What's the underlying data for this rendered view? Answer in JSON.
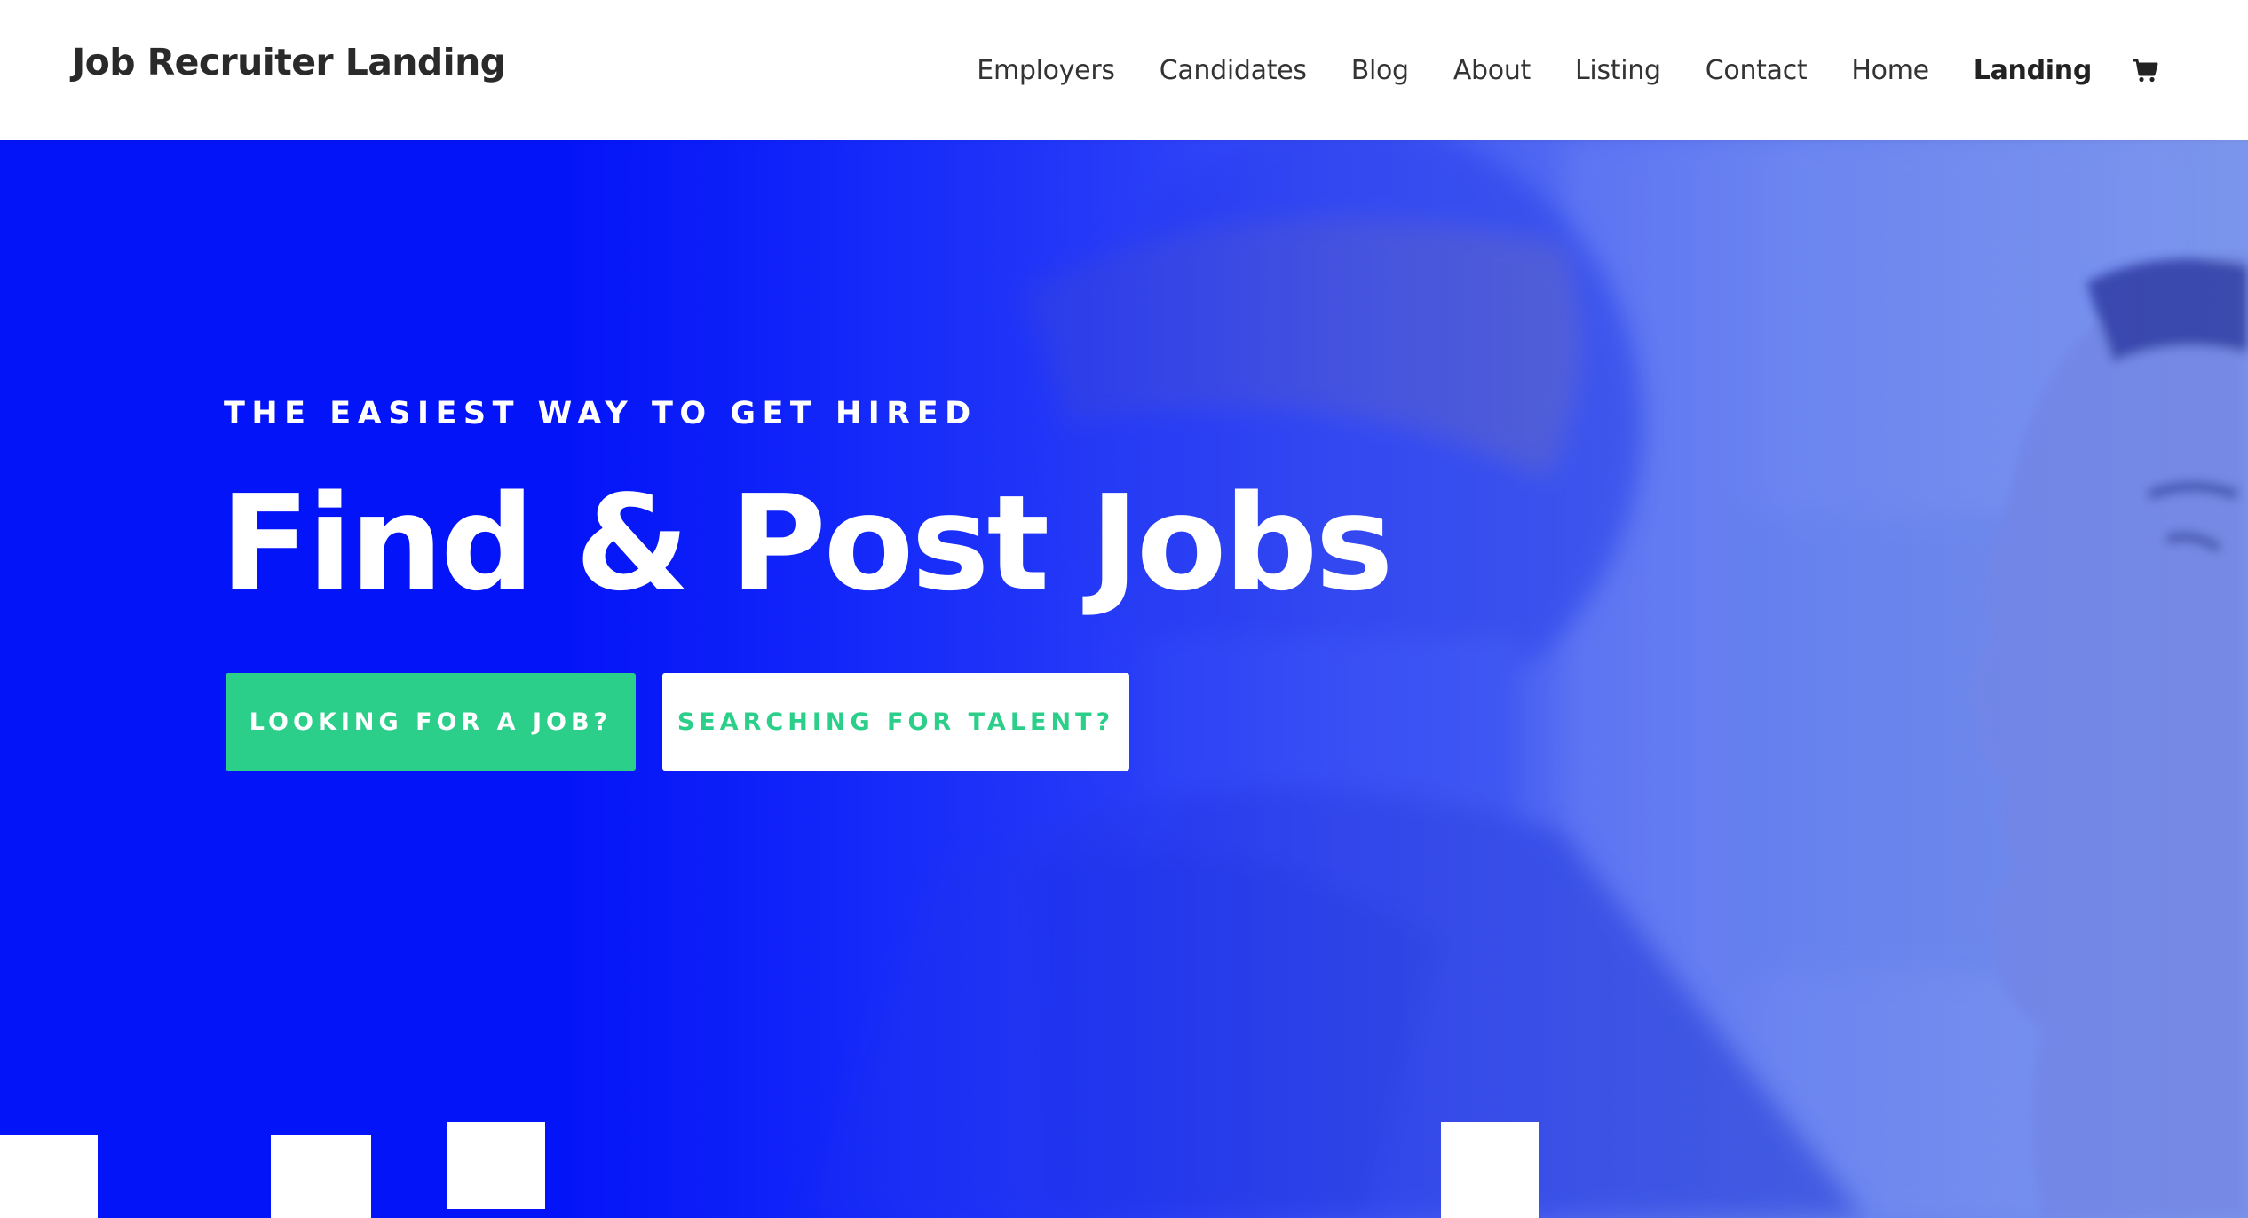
{
  "header": {
    "logo": "Job Recruiter Landing",
    "nav": [
      {
        "label": "Employers",
        "active": false
      },
      {
        "label": "Candidates",
        "active": false
      },
      {
        "label": "Blog",
        "active": false
      },
      {
        "label": "About",
        "active": false
      },
      {
        "label": "Listing",
        "active": false
      },
      {
        "label": "Contact",
        "active": false
      },
      {
        "label": "Home",
        "active": false
      },
      {
        "label": "Landing",
        "active": true
      }
    ],
    "cart_icon": "shopping-cart-icon"
  },
  "hero": {
    "eyebrow": "THE EASIEST WAY TO GET HIRED",
    "headline": "Find & Post Jobs",
    "buttons": {
      "job": "LOOKING FOR A JOB?",
      "talent": "SEARCHING FOR TALENT?"
    }
  },
  "colors": {
    "hero_blue": "#0418f3",
    "accent_green": "#2bcf8a",
    "text_dark": "#333333",
    "white": "#ffffff"
  }
}
